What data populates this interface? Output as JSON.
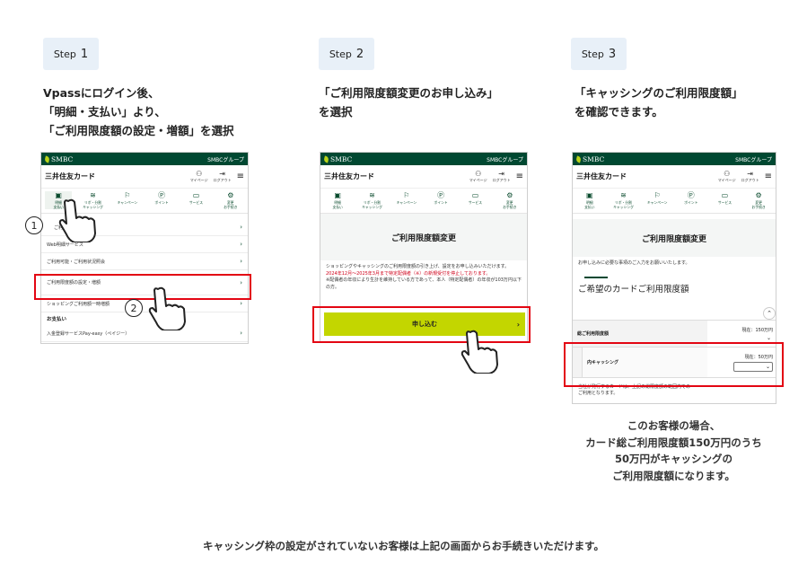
{
  "steps": [
    {
      "label": "Step",
      "num": "1",
      "desc": "Vpassにログイン後、\n「明細・支払い」より、\n「ご利用限度額の設定・増額」を選択"
    },
    {
      "label": "Step",
      "num": "2",
      "desc": "「ご利用限度額変更のお申し込み」\nを選択"
    },
    {
      "label": "Step",
      "num": "3",
      "desc": "「キャッシングのご利用限度額」\nを確認できます。"
    }
  ],
  "phone": {
    "bank": "SMBC",
    "group": "SMBCグループ",
    "brand": "三井住友カード",
    "mypage": "マイページ",
    "logout": "ログアウト",
    "nav": [
      {
        "icon": "▣",
        "label": "明細\n支払い"
      },
      {
        "icon": "≋",
        "label": "リボ・分割\nキャッシング"
      },
      {
        "icon": "⚐",
        "label": "キャンペーン"
      },
      {
        "icon": "Ⓟ",
        "label": "ポイント"
      },
      {
        "icon": "▭",
        "label": "サービス"
      },
      {
        "icon": "⚙",
        "label": "変更\nお手続き"
      }
    ]
  },
  "screen1": {
    "rows": [
      "ご利用明細照会",
      "Web明細サービス",
      "ご利用可能・ご利用状況照会",
      "ご利用限度額の設定・増額",
      "ショッピングご利用額一時増額"
    ],
    "section": "お支払い",
    "last_row": "入金登録サービスPay-easy（ペイジー）"
  },
  "screen2": {
    "title": "ご利用限度額変更",
    "text": "ショッピングやキャッシングのご利用限度額の引き上げ、設定をお申し込みいただけます。",
    "red_text": "2024年12月〜2025年3月まで特定配偶者（※）の新規受付を停止しております。",
    "note": "※配偶者の年収により生計を維持している方であって、本人（特定配偶者）の年収が103万円以下の方。",
    "button": "申し込む"
  },
  "screen3": {
    "title": "ご利用限度額変更",
    "intro": "お申し込みに必要な事項のご入力をお願いいたします。",
    "section": "ご希望のカードご利用限度額",
    "total_label": "総ご利用限度額",
    "total_current": "現在：150万円",
    "cashing_label": "内キャッシング",
    "cashing_current": "現在：50万円",
    "footnote": "当社が発行するカードは、上記の総限度額の範囲内での\nご利用となります。"
  },
  "markers": [
    "1",
    "2"
  ],
  "caption": "このお客様の場合、\nカード総ご利用限度額150万円のうち\n50万円がキャッシングの\nご利用限度額になります。",
  "footer": "キャッシング枠の設定がされていないお客様は上記の画面からお手続きいただけます。",
  "colors": {
    "accent_red": "#e30613",
    "smbc_green": "#004831",
    "button_lime": "#c3d600"
  }
}
